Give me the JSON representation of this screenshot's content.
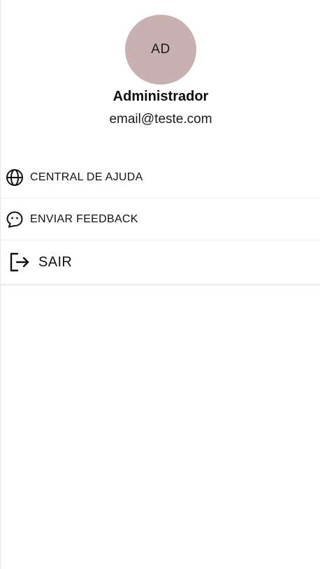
{
  "profile": {
    "initials": "AD",
    "name": "Administrador",
    "email": "email@teste.com",
    "avatar_color": "#c9b0b1"
  },
  "menu": {
    "items": [
      {
        "label": "CENTRAL DE AJUDA",
        "icon": "globe-icon"
      },
      {
        "label": "ENVIAR FEEDBACK",
        "icon": "feedback-face-icon"
      },
      {
        "label": "SAIR",
        "icon": "logout-icon"
      }
    ]
  }
}
